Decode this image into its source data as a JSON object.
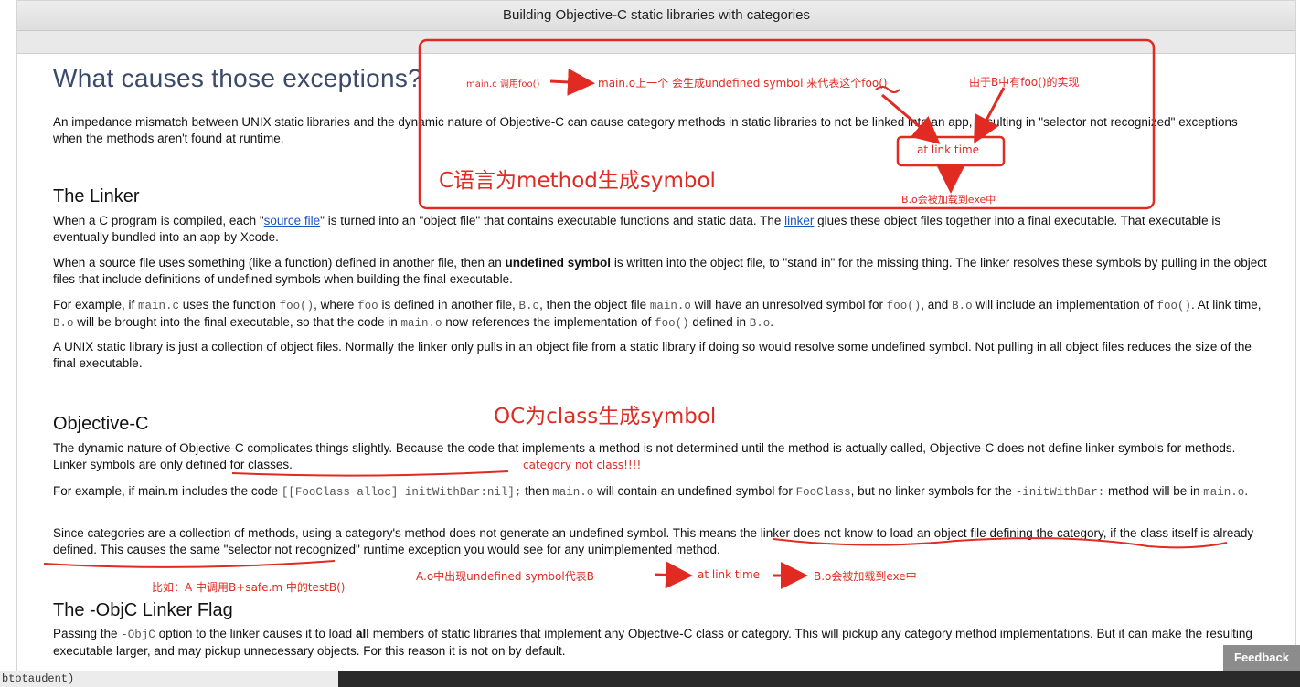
{
  "window": {
    "title": "Building Objective-C static libraries with categories"
  },
  "article": {
    "h1": "What causes those exceptions?",
    "intro": "An impedance mismatch between UNIX static libraries and the dynamic nature of Objective-C can cause category methods in static libraries to not be linked into an app, resulting in \"selector not recognized\" exceptions when the methods aren't found at runtime.",
    "linker": {
      "heading": "The Linker",
      "p1_a": "When a C program is compiled, each \"",
      "p1_link1": "source file",
      "p1_b": "\" is turned into an \"object file\" that contains executable functions and static data. The ",
      "p1_link2": "linker",
      "p1_c": " glues these object files together into a final executable. That executable is eventually bundled into an app by Xcode.",
      "p2_a": "When a source file uses something (like a function) defined in another file, then an ",
      "p2_bold": "undefined symbol",
      "p2_b": " is written into the object file, to \"stand in\" for the missing thing. The linker resolves these symbols by pulling in the object files that include definitions of undefined symbols when building the final executable.",
      "p3": [
        {
          "t": "For example, if "
        },
        {
          "c": "main.c"
        },
        {
          "t": " uses the function "
        },
        {
          "c": "foo()"
        },
        {
          "t": ", where "
        },
        {
          "c": "foo"
        },
        {
          "t": " is defined in another file, "
        },
        {
          "c": "B.c"
        },
        {
          "t": ", then the object file "
        },
        {
          "c": "main.o"
        },
        {
          "t": " will have an unresolved symbol for "
        },
        {
          "c": "foo()"
        },
        {
          "t": ", and "
        },
        {
          "c": "B.o"
        },
        {
          "t": " will include an implementation of "
        },
        {
          "c": "foo()"
        },
        {
          "t": ". At link time, "
        },
        {
          "c": "B.o"
        },
        {
          "t": " will be brought into the final executable, so that the code in "
        },
        {
          "c": "main.o"
        },
        {
          "t": " now references the implementation of "
        },
        {
          "c": "foo()"
        },
        {
          "t": " defined in "
        },
        {
          "c": "B.o"
        },
        {
          "t": "."
        }
      ],
      "p4": "A UNIX static library is just a collection of object files. Normally the linker only pulls in an object file from a static library if doing so would resolve some undefined symbol. Not pulling in all object files reduces the size of the final executable."
    },
    "objc": {
      "heading": "Objective-C",
      "p1": "The dynamic nature of Objective-C complicates things slightly. Because the code that implements a method is not determined until the method is actually called, Objective-C does not define linker symbols for methods. Linker symbols are only defined for classes.",
      "p2": [
        {
          "t": "For example, if main.m includes the code "
        },
        {
          "c": "[[FooClass alloc] initWithBar:nil];"
        },
        {
          "t": " then "
        },
        {
          "c": "main.o"
        },
        {
          "t": " will contain an undefined symbol for "
        },
        {
          "c": "FooClass"
        },
        {
          "t": ", but no linker symbols for the "
        },
        {
          "c": "-initWithBar:"
        },
        {
          "t": " method will be in "
        },
        {
          "c": "main.o"
        },
        {
          "t": "."
        }
      ],
      "p3": "Since categories are a collection of methods, using a category's method does not generate an undefined symbol. This means the linker does not know to load an object file defining the category, if the class itself is already defined. This causes the same \"selector not recognized\" runtime exception you would see for any unimplemented method."
    },
    "flag": {
      "heading": "The -ObjC Linker Flag",
      "p1": [
        {
          "t": "Passing the "
        },
        {
          "c": "-ObjC"
        },
        {
          "t": " option to the linker causes it to load "
        },
        {
          "b": "all"
        },
        {
          "t": " members of static libraries that implement any Objective-C class or category. This will pickup any category method implementations. But it can make the resulting executable larger, and may pickup unnecessary objects. For this reason it is not on by default."
        }
      ]
    }
  },
  "annotations": {
    "main_c_call": "main.c 调用foo()",
    "main_o_symbol": "main.o上一个 会生成undefined symbol 来代表这个foo()",
    "b_has_impl": "由于B中有foo()的实现",
    "at_link_time_box": "at link  time",
    "c_method_symbol": "C语言为method生成symbol",
    "b_o_loaded_top": "B.o会被加载到exe中",
    "oc_class_symbol": "OC为class生成symbol",
    "category_not_class": "category not class!!!!",
    "example_b": "比如：A 中调用B+safe.m 中的testB()",
    "a_o_undefined": "A.o中出现undefined symbol代表B",
    "at_link_time_bottom": "at link time",
    "b_o_loaded_bottom": "B.o会被加载到exe中",
    "color": "#e02a22"
  },
  "feedback": {
    "label": "Feedback"
  },
  "terminal": {
    "text": "btotaudent)"
  }
}
